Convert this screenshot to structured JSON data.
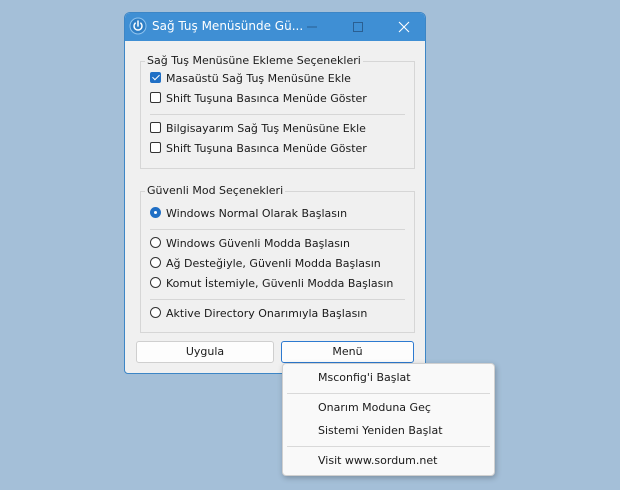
{
  "window": {
    "title": "Sağ Tuş Menüsünde Gü...",
    "accent": "#3f8fd4"
  },
  "context_group": {
    "title": "Sağ Tuş Menüsüne Ekleme Seçenekleri",
    "options": [
      {
        "label": "Masaüstü Sağ Tuş Menüsüne Ekle",
        "checked": true
      },
      {
        "label": "Shift Tuşuna Basınca Menüde Göster",
        "checked": false
      },
      {
        "label": "Bilgisayarım Sağ Tuş Menüsüne Ekle",
        "checked": false
      },
      {
        "label": "Shift Tuşuna Basınca Menüde Göster",
        "checked": false
      }
    ]
  },
  "safe_group": {
    "title": "Güvenli Mod Seçenekleri",
    "options": [
      {
        "label": "Windows Normal Olarak Başlasın",
        "selected": true
      },
      {
        "label": "Windows Güvenli Modda Başlasın",
        "selected": false
      },
      {
        "label": "Ağ Desteğiyle, Güvenli Modda Başlasın",
        "selected": false
      },
      {
        "label": "Komut İstemiyle, Güvenli Modda Başlasın",
        "selected": false
      },
      {
        "label": "Aktive Directory Onarımıyla Başlasın",
        "selected": false
      }
    ]
  },
  "buttons": {
    "apply": "Uygula",
    "menu": "Menü"
  },
  "menu": {
    "items": [
      "Msconfig'i Başlat",
      "Onarım Moduna Geç",
      "Sistemi Yeniden Başlat",
      "Visit www.sordum.net"
    ]
  }
}
